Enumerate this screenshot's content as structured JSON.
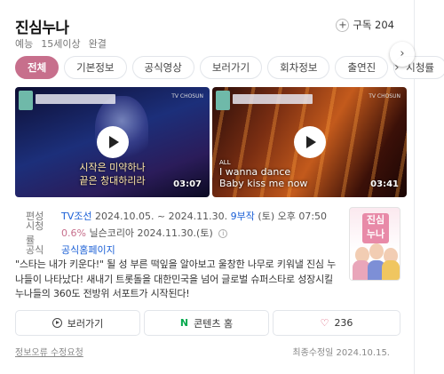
{
  "header": {
    "title": "진심누나",
    "meta": [
      "예능",
      "15세이상",
      "완결"
    ],
    "subscribe_label": "구독 204"
  },
  "tabs": [
    {
      "label": "전체",
      "active": true
    },
    {
      "label": "기본정보"
    },
    {
      "label": "공식영상"
    },
    {
      "label": "보러가기"
    },
    {
      "label": "회차정보"
    },
    {
      "label": "출연진"
    },
    {
      "label": "시청률"
    }
  ],
  "videos": [
    {
      "caption_lines": [
        "시작은 미약하나",
        "끝은 창대하리라"
      ],
      "duration": "03:07",
      "channel": "TV CHOSUN"
    },
    {
      "caption_top": "ALL",
      "caption_lines": [
        "I wanna dance",
        "Baby kiss me now"
      ],
      "duration": "03:41",
      "channel": "TV CHOSUN"
    }
  ],
  "info": {
    "broadcast_label": "편성",
    "channel": "TV조선",
    "period": "2024.10.05. ~ 2024.11.30.",
    "episodes": "9부작",
    "schedule": "(토) 오후 07:50",
    "rating_label": "시청률",
    "rating": "0.6%",
    "rating_source": "닐슨코리아 2024.11.30.(토)",
    "official_label": "공식",
    "official_link": "공식홈페이지"
  },
  "poster": {
    "logo_text": "진심누나"
  },
  "description": "\"스타는 내가 키운다!\" 될 성 부른 떡잎을 알아보고 울창한 나무로 키워낼 진심 누나들이 나타났다! 새내기 트롯돌을 대한민국을 넘어 글로벌 슈퍼스타로 성장시킬 누나들의 360도 전방위 서포트가 시작된다!",
  "actions": {
    "watch_label": "보러가기",
    "content_home_label": "콘텐츠 홈",
    "like_count": "236"
  },
  "footer": {
    "report": "정보오류 수정요청",
    "updated": "최종수정일 2024.10.15."
  },
  "colors": {
    "accent": "#c76f8c",
    "link": "#1a5fd6",
    "naver": "#03a94d"
  }
}
